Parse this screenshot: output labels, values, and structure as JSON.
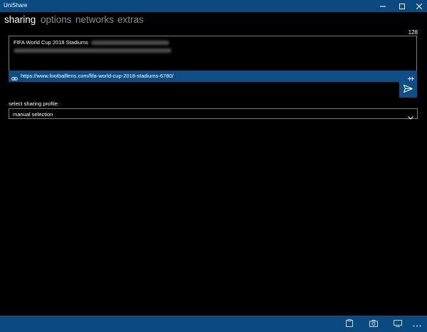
{
  "window": {
    "title": "UniShare",
    "controls": [
      "minimize-icon",
      "maximize-icon",
      "close-icon"
    ]
  },
  "tabs": [
    {
      "label": "sharing",
      "active": true
    },
    {
      "label": "options",
      "active": false
    },
    {
      "label": "networks",
      "active": false
    },
    {
      "label": "extras",
      "active": false
    }
  ],
  "composer": {
    "char_count": "128",
    "message_title": "FIFA World Cup 2018 Stadiums",
    "url": "https://www.footballlens.com/fifa-world-cup-2018-stadiums-6780/",
    "link_icon": "link-icon",
    "collapse_icon": "collapse-icon",
    "send_icon": "send-icon"
  },
  "profile": {
    "label": "select sharing profile:",
    "selected": "manual selection"
  },
  "appbar": {
    "icons": [
      "clipboard-icon",
      "camera-icon",
      "display-icon",
      "more-icon"
    ]
  },
  "colors": {
    "accent": "#0a4a80",
    "background": "#000000",
    "inactive_tab": "#8d8d8d",
    "border": "#7a7a7a"
  }
}
